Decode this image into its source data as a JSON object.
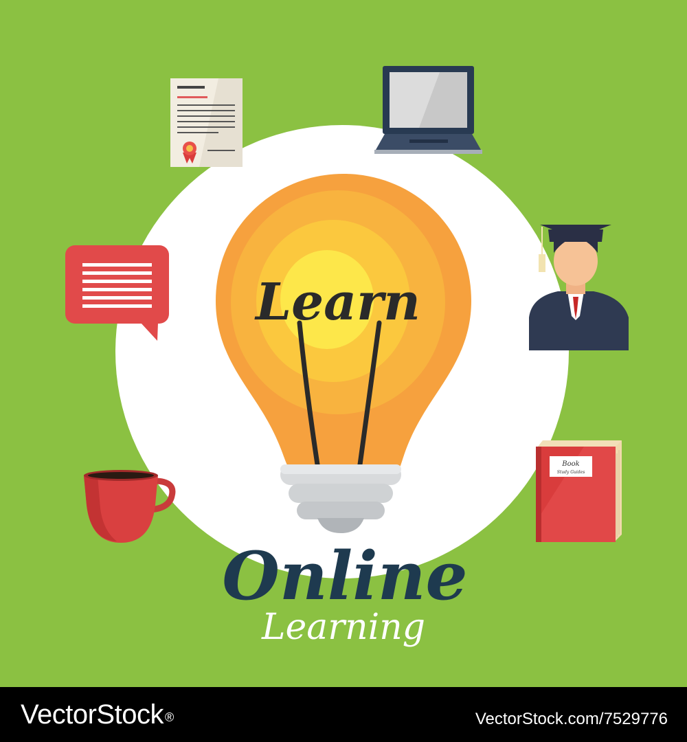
{
  "colors": {
    "background": "#8bc142",
    "circle": "#ffffff",
    "bulb_outer": "#f6a13e",
    "bulb_mid": "#f8b33f",
    "bulb_inner": "#fbc83e",
    "bulb_core": "#fde74a",
    "filament": "#2a2a2a",
    "title_dark": "#1e3a4f",
    "title_light": "#ffffff",
    "footer": "#000000",
    "red": "#e04848",
    "navy": "#2f3a52"
  },
  "bulb": {
    "word": "Learn"
  },
  "title": {
    "line1": "Online",
    "line2": "Learning"
  },
  "book": {
    "title": "Book",
    "subtitle": "Study Guides"
  },
  "icons": [
    "certificate-icon",
    "laptop-icon",
    "chat-bubble-icon",
    "graduate-icon",
    "coffee-cup-icon",
    "book-icon",
    "light-bulb-icon"
  ],
  "footer": {
    "logo": "VectorStock",
    "logo_mark": "®",
    "credit": "VectorStock.com/7529776"
  }
}
